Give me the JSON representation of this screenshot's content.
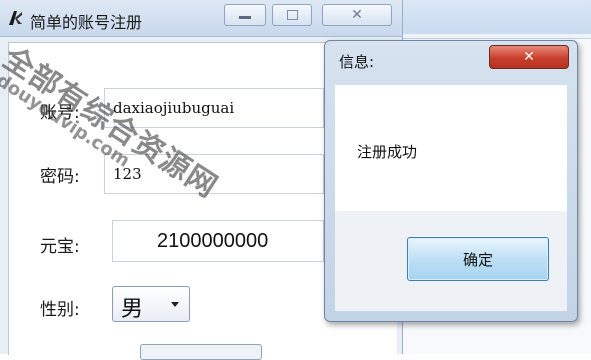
{
  "main_window": {
    "title": "简单的账号注册",
    "controls": {
      "minimize": "—",
      "maximize": "□",
      "close": "✕"
    }
  },
  "form": {
    "account": {
      "label": "账号:",
      "value": "daxiaojiubuguai"
    },
    "password": {
      "label": "密码:",
      "value": "123"
    },
    "yuanbao": {
      "label": "元宝:",
      "value": "2100000000"
    },
    "gender": {
      "label": "性别:",
      "value": "男"
    }
  },
  "dialog": {
    "title": "信息:",
    "message": "注册成功",
    "ok_label": "确定",
    "close_label": "✕"
  },
  "watermark": {
    "text": "全部有综合资源网",
    "url": "douyouvip.com"
  },
  "colors": {
    "dialog_close_red": "#c8402c",
    "ok_button_blue": "#bfe0f6",
    "titlebar": "#c8d8ec"
  },
  "icons": {
    "app": "app-icon"
  }
}
